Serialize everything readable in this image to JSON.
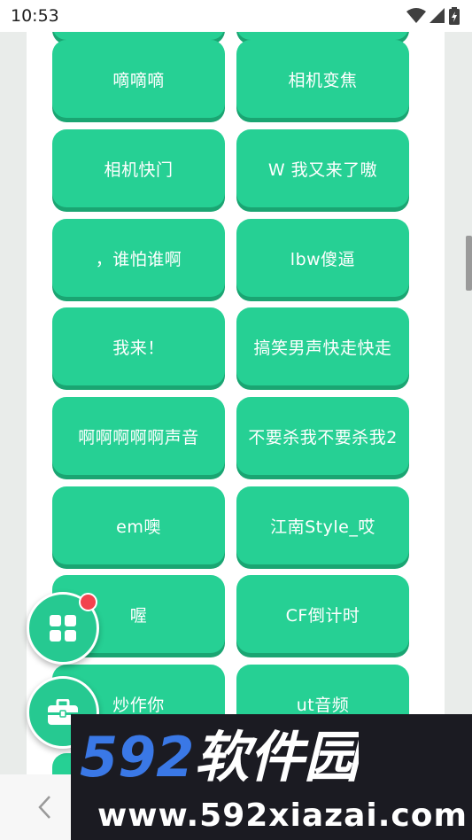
{
  "status_bar": {
    "time": "10:53"
  },
  "buttons": [
    {
      "label": "嘀嘀嘀"
    },
    {
      "label": "相机变焦"
    },
    {
      "label": "相机快门"
    },
    {
      "label": "W 我又来了嗷"
    },
    {
      "label": "，谁怕谁啊"
    },
    {
      "label": "lbw傻逼"
    },
    {
      "label": "我来！"
    },
    {
      "label": "搞笑男声快走快走"
    },
    {
      "label": "啊啊啊啊啊声音"
    },
    {
      "label": "不要杀我不要杀我2"
    },
    {
      "label": "em噢"
    },
    {
      "label": "江南Style_哎"
    },
    {
      "label": "喔"
    },
    {
      "label": "CF倒计时"
    },
    {
      "label": "炒作你"
    },
    {
      "label": "ut音频"
    }
  ],
  "fabs": [
    {
      "icon": "grid-icon",
      "has_badge": true
    },
    {
      "icon": "toolbox-icon",
      "has_badge": false
    }
  ],
  "watermark": {
    "brand": "592软件园",
    "url": "www.592xiazai.com"
  },
  "colors": {
    "button": "#26d094",
    "button_shadow": "#1aa572",
    "badge": "#f2424e",
    "watermark_bg": "#1b1b22",
    "brand_blue": "#3a78e6"
  }
}
